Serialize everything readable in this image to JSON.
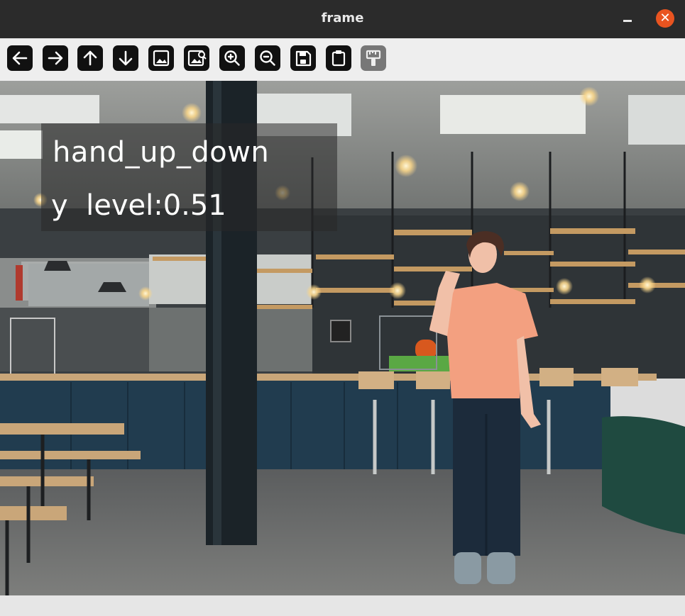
{
  "window": {
    "title": "frame"
  },
  "toolbar": {
    "buttons": [
      {
        "name": "pan-left",
        "icon": "arrow-left-icon"
      },
      {
        "name": "pan-right",
        "icon": "arrow-right-icon"
      },
      {
        "name": "pan-up",
        "icon": "arrow-up-icon"
      },
      {
        "name": "pan-down",
        "icon": "arrow-down-icon"
      },
      {
        "name": "zoom-in-image",
        "icon": "image-icon"
      },
      {
        "name": "zoom-out-image",
        "icon": "image-search-icon"
      },
      {
        "name": "zoom-in",
        "icon": "zoom-in-icon"
      },
      {
        "name": "zoom-out",
        "icon": "zoom-out-icon"
      },
      {
        "name": "save",
        "icon": "floppy-disk-icon"
      },
      {
        "name": "copy",
        "icon": "clipboard-icon"
      },
      {
        "name": "properties",
        "icon": "paint-brush-icon"
      }
    ]
  },
  "overlay": {
    "gesture_label": "hand_up_down",
    "y_level_label": "y  level:0.51"
  }
}
